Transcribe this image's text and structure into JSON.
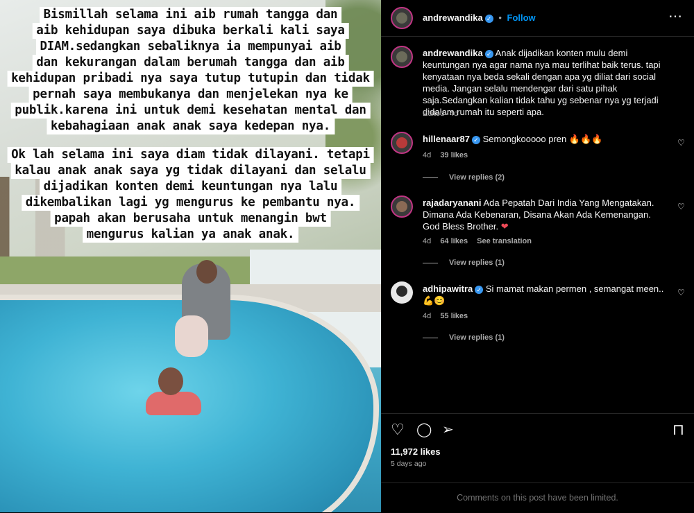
{
  "overlay_text": [
    "Bismillah selama ini aib rumah tangga dan",
    "aib kehidupan saya dibuka berkali kali saya",
    "DIAM.sedangkan sebaliknya ia mempunyai aib",
    "dan kekurangan dalam berumah tangga dan aib",
    "kehidupan pribadi nya saya tutup tutupin dan tidak",
    "pernah saya membukanya dan menjelekan nya ke",
    "publik.karena ini untuk demi kesehatan mental dan",
    "kebahagiaan anak anak saya kedepan nya.",
    "Ok lah selama ini saya diam tidak dilayani. tetapi",
    "kalau anak anak saya yg tidak dilayani dan selalu",
    "dijadikan konten demi keuntungan nya lalu",
    "dikembalikan lagi yg mengurus ke pembantu nya.",
    "papah akan berusaha untuk menangin bwt",
    "mengurus kalian ya anak anak."
  ],
  "header": {
    "username": "andrewandika",
    "separator": "•",
    "follow_label": "Follow",
    "more_icon": "⋯"
  },
  "caption": {
    "username": "andrewandika",
    "text": "Anak dijadikan konten mulu demi keuntungan nya agar nama nya mau terlihat baik terus. tapi kenyataan nya beda sekali dengan apa yg diliat dari social media. Jangan selalu mendengar dari satu pihak saja.Sedangkan kalian tidak tahu yg sebenar nya yg terjadi didalam rumah itu seperti apa.",
    "edited": "Edited",
    "age": "4d"
  },
  "comments": [
    {
      "username": "hillenaar87",
      "text": "Semongkooooo pren",
      "emoji": "🔥🔥🔥",
      "age": "4d",
      "likes": "39 likes",
      "translate": "",
      "view_replies": "View replies (2)"
    },
    {
      "username": "rajadaryanani",
      "text": "Ada Pepatah Dari India Yang Mengatakan. Dimana Ada Kebenaran, Disana Akan Ada Kemenangan. God Bless Brother.",
      "emoji": "❤",
      "age": "4d",
      "likes": "64 likes",
      "translate": "See translation",
      "view_replies": "View replies (1)"
    },
    {
      "username": "adhipawitra",
      "text": "Si mamat makan permen , semangat meen..",
      "emoji": "💪😊",
      "age": "4d",
      "likes": "55 likes",
      "translate": "",
      "view_replies": "View replies (1)"
    }
  ],
  "actions": {
    "like_icon": "♡",
    "comment_icon": "◯",
    "share_icon": "➢",
    "save_icon": "⊓"
  },
  "post": {
    "likes": "11,972 likes",
    "date": "5 days ago"
  },
  "limited_notice": "Comments on this post have been limited.",
  "colors": {
    "accent": "#0095f6",
    "verified": "#3897f0",
    "muted": "#a8a8a8",
    "background": "#000000"
  }
}
